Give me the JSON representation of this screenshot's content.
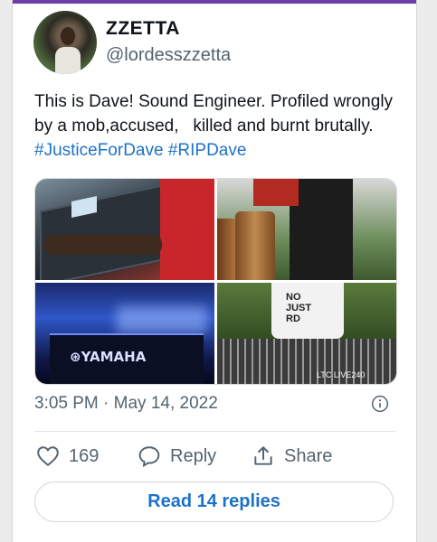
{
  "author": {
    "display_name": "ZZETTA",
    "handle": "@lordesszzetta"
  },
  "tweet": {
    "text": "This is Dave! Sound Engineer. Profiled wrongly by a mob,accused,   killed and burnt brutally. ",
    "hashtags": [
      "#JusticeForDave",
      "#RIPDave"
    ],
    "timestamp": "3:05 PM · May 14, 2022"
  },
  "media": {
    "photo_3_brand": "YAMAHA",
    "photo_4_shirt_text": "NO\nJUST\nRD",
    "photo_4_mixer_label": "LTC  LIVE240"
  },
  "actions": {
    "like_count": "169",
    "reply_label": "Reply",
    "share_label": "Share"
  },
  "read_replies_label": "Read 14 replies",
  "colors": {
    "link": "#1d72c9",
    "secondary_text": "#536471",
    "frame_accent": "#6b3fa8"
  },
  "icons": [
    "heart-icon",
    "reply-icon",
    "share-icon",
    "info-icon"
  ]
}
